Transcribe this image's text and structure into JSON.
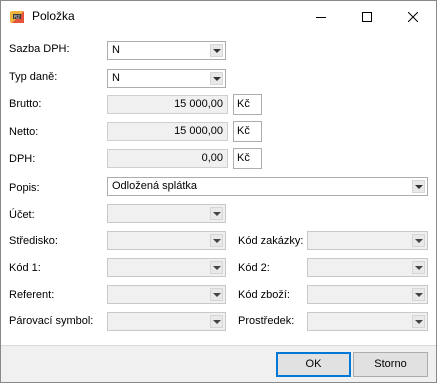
{
  "window": {
    "title": "Položka",
    "icon": "app-logo-icon"
  },
  "form": {
    "sazba_dph": {
      "label": "Sazba DPH:",
      "value": "N"
    },
    "typ_dane": {
      "label": "Typ daně:",
      "value": "N"
    },
    "brutto": {
      "label": "Brutto:",
      "value": "15 000,00",
      "currency": "Kč"
    },
    "netto": {
      "label": "Netto:",
      "value": "15 000,00",
      "currency": "Kč"
    },
    "dph": {
      "label": "DPH:",
      "value": "0,00",
      "currency": "Kč"
    },
    "popis": {
      "label": "Popis:",
      "value": "Odložená splátka"
    },
    "ucet": {
      "label": "Účet:",
      "value": ""
    },
    "stredisko": {
      "label": "Středisko:",
      "value": ""
    },
    "kod_zakazky": {
      "label": "Kód zakázky:",
      "value": ""
    },
    "kod1": {
      "label": "Kód 1:",
      "value": ""
    },
    "kod2": {
      "label": "Kód 2:",
      "value": ""
    },
    "referent": {
      "label": "Referent:",
      "value": ""
    },
    "kod_zbozi": {
      "label": "Kód zboží:",
      "value": ""
    },
    "parovaci_symbol": {
      "label": "Párovací symbol:",
      "value": ""
    },
    "prostredek": {
      "label": "Prostředek:",
      "value": ""
    }
  },
  "buttons": {
    "ok": "OK",
    "storno": "Storno"
  }
}
